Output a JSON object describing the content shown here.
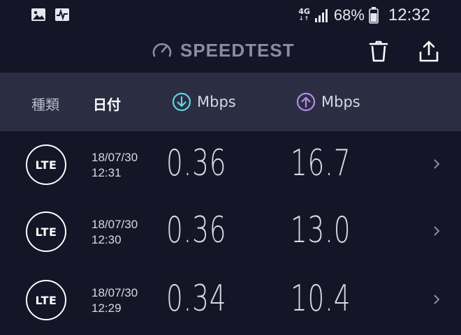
{
  "status_bar": {
    "network": "4G",
    "battery": "68%",
    "time": "12:32",
    "icons": [
      "image-icon",
      "activity-icon",
      "signal-icon",
      "battery-icon"
    ]
  },
  "app_bar": {
    "title": "SPEEDTEST",
    "actions": [
      "trash-icon",
      "share-icon"
    ]
  },
  "header": {
    "type": "種類",
    "date": "日付",
    "download": "Mbps",
    "upload": "Mbps"
  },
  "colors": {
    "background": "#141526",
    "header_bg": "#2b2e43",
    "download_accent": "#5fd6e0",
    "upload_accent": "#b98ae6"
  },
  "results": [
    {
      "type": "LTE",
      "date": "18/07/30",
      "time": "12:31",
      "download": "0.36",
      "upload": "16.7"
    },
    {
      "type": "LTE",
      "date": "18/07/30",
      "time": "12:30",
      "download": "0.36",
      "upload": "13.0"
    },
    {
      "type": "LTE",
      "date": "18/07/30",
      "time": "12:29",
      "download": "0.34",
      "upload": "10.4"
    }
  ]
}
